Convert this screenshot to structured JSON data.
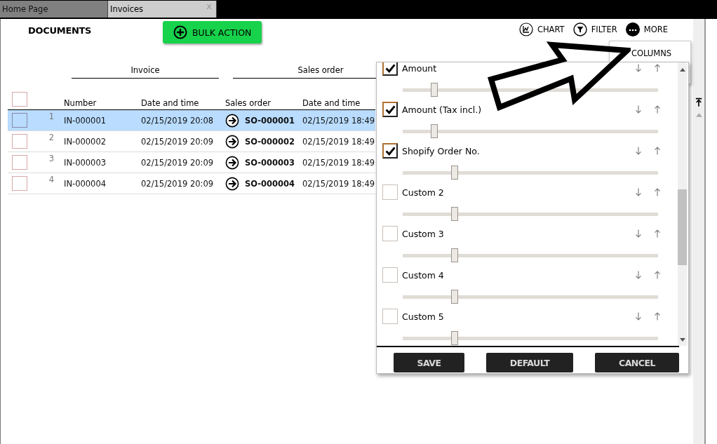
{
  "tabs": [
    {
      "label": "Home Page",
      "selected": false
    },
    {
      "label": "Invoices",
      "selected": true,
      "close": "x"
    }
  ],
  "title": "DOCUMENTS",
  "bulk_action": "BULK ACTION",
  "toolbar": [
    {
      "label": "CHART",
      "kind": "chart"
    },
    {
      "label": "FILTER",
      "kind": "filter"
    },
    {
      "label": "MORE",
      "kind": "more"
    }
  ],
  "table": {
    "select_all": {
      "checked": false
    },
    "groups": [
      "Invoice",
      "Sales order"
    ],
    "columns": [
      "Number",
      "Date and time",
      "Sales order",
      "Date and time"
    ],
    "rows": [
      {
        "index": "1",
        "number": "IN-000001",
        "date": "02/15/2019 20:08",
        "sales_order": "SO-000001",
        "so_date": "02/15/2019 18:49",
        "selected": true,
        "checked": false
      },
      {
        "index": "2",
        "number": "IN-000002",
        "date": "02/15/2019 20:09",
        "sales_order": "SO-000002",
        "so_date": "02/15/2019 18:49",
        "selected": false,
        "checked": false
      },
      {
        "index": "3",
        "number": "IN-000003",
        "date": "02/15/2019 20:09",
        "sales_order": "SO-000003",
        "so_date": "02/15/2019 18:49",
        "selected": false,
        "checked": false
      },
      {
        "index": "4",
        "number": "IN-000004",
        "date": "02/15/2019 20:09",
        "sales_order": "SO-000004",
        "so_date": "02/15/2019 18:49",
        "selected": false,
        "checked": false
      }
    ]
  },
  "more_menu": {
    "items": [
      "COLUMNS"
    ]
  },
  "columns_panel": {
    "items": [
      {
        "label": "Amount",
        "checked": true,
        "level": 0.11
      },
      {
        "label": "Amount (Tax incl.)",
        "checked": true,
        "level": 0.11
      },
      {
        "label": "Shopify Order No.",
        "checked": true,
        "level": 0.19
      },
      {
        "label": "Custom 2",
        "checked": false,
        "level": 0.19
      },
      {
        "label": "Custom 3",
        "checked": false,
        "level": 0.19
      },
      {
        "label": "Custom 4",
        "checked": false,
        "level": 0.19
      },
      {
        "label": "Custom 5",
        "checked": false,
        "level": 0.19
      }
    ],
    "buttons": [
      "SAVE",
      "DEFAULT",
      "CANCEL"
    ]
  }
}
